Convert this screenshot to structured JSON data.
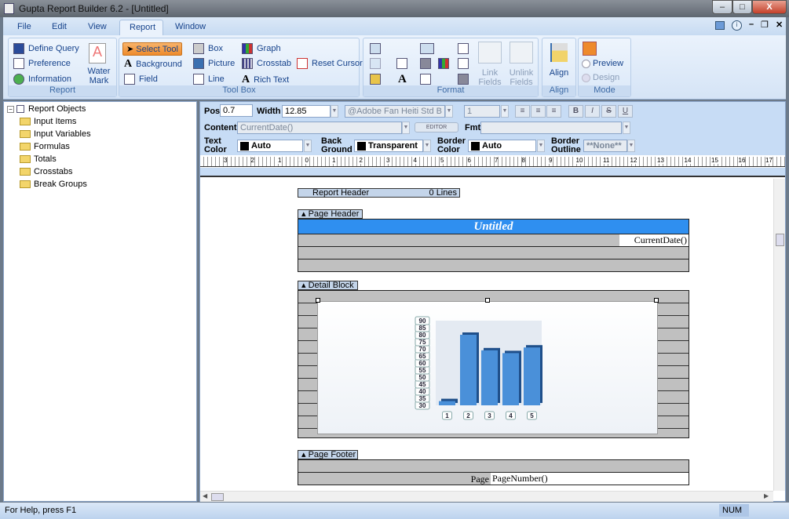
{
  "window": {
    "title": "Gupta Report Builder 6.2 - [Untitled]",
    "minimize": "–",
    "maximize": "□",
    "close": "X"
  },
  "menu": {
    "tabs": [
      {
        "label": "File"
      },
      {
        "label": "Edit"
      },
      {
        "label": "View"
      },
      {
        "label": "Report",
        "active": true
      },
      {
        "label": "Window"
      }
    ]
  },
  "ribbon": {
    "report": {
      "label": "Report",
      "items": [
        {
          "label": "Define Query",
          "icon": "query-icon"
        },
        {
          "label": "Preference",
          "icon": "preference-icon"
        },
        {
          "label": "Information",
          "icon": "information-icon"
        }
      ],
      "watermark": "Water Mark"
    },
    "toolbox": {
      "label": "Tool Box",
      "items": [
        {
          "label": "Select Tool",
          "icon": "pointer-icon",
          "selected": true
        },
        {
          "label": "Background",
          "icon": "text-a-icon"
        },
        {
          "label": "Field",
          "icon": "field-icon"
        },
        {
          "label": "Box",
          "icon": "box-icon"
        },
        {
          "label": "Picture",
          "icon": "picture-icon"
        },
        {
          "label": "Line",
          "icon": "line-icon"
        },
        {
          "label": "Graph",
          "icon": "graph-icon"
        },
        {
          "label": "Crosstab",
          "icon": "crosstab-icon"
        },
        {
          "label": "Rich Text",
          "icon": "rich-text-icon"
        },
        {
          "label": "Reset Cursor",
          "icon": "reset-cursor-icon"
        }
      ]
    },
    "format": {
      "label": "Format",
      "link_fields": "Link Fields",
      "unlink_fields": "Unlink Fields"
    },
    "align": {
      "label": "Align",
      "button": "Align"
    },
    "mode": {
      "label": "Mode",
      "preview": "Preview",
      "design": "Design"
    }
  },
  "tree": {
    "root": "Report Objects",
    "items": [
      "Input Items",
      "Input Variables",
      "Formulas",
      "Totals",
      "Crosstabs",
      "Break Groups"
    ]
  },
  "props": {
    "pos_label": "Pos",
    "pos": "0.7",
    "width_label": "Width",
    "width": "12.85",
    "font": "@Adobe Fan Heiti Std B",
    "size": "1",
    "content_label": "Content",
    "content": "CurrentDate()",
    "editor": "EDITOR",
    "fmt_label": "Fmt",
    "fmt": "",
    "text_color_label": "Text Color",
    "text_color": "Auto",
    "background_label": "Back Ground",
    "background": "Transparent",
    "border_color_label": "Border Color",
    "border_color": "Auto",
    "border_outline_label": "Border Outline",
    "border_outline": "**None**",
    "bold": "B",
    "italic": "I",
    "strike": "S",
    "underline": "U"
  },
  "ruler": {
    "labels": [
      "3",
      "2",
      "1",
      "0",
      "1",
      "2",
      "3",
      "4",
      "5",
      "6",
      "7",
      "8",
      "9",
      "10",
      "11",
      "12",
      "13",
      "14",
      "15",
      "16",
      "17",
      "18"
    ]
  },
  "report": {
    "report_header": {
      "label": "Report Header",
      "lines": "0 Lines"
    },
    "page_header": {
      "label": "Page Header",
      "title": "Untitled",
      "date": "CurrentDate()"
    },
    "detail_block": {
      "label": "Detail Block"
    },
    "page_footer": {
      "label": "Page Footer",
      "page_label": "Page",
      "page_number": "PageNumber()"
    }
  },
  "chart_data": {
    "type": "bar",
    "categories": [
      "1",
      "2",
      "3",
      "4",
      "5"
    ],
    "values": [
      33,
      80,
      69,
      67,
      71
    ],
    "ylim": [
      30,
      90
    ],
    "yticks": [
      "30",
      "35",
      "40",
      "45",
      "50",
      "55",
      "60",
      "65",
      "70",
      "75",
      "80",
      "85",
      "90"
    ],
    "color": "#4a90d9",
    "style": "3d"
  },
  "status": {
    "help": "For Help, press F1",
    "num": "NUM"
  },
  "colors": {
    "accent": "#2f8ff0",
    "ribbon": "#dbe8f7"
  }
}
